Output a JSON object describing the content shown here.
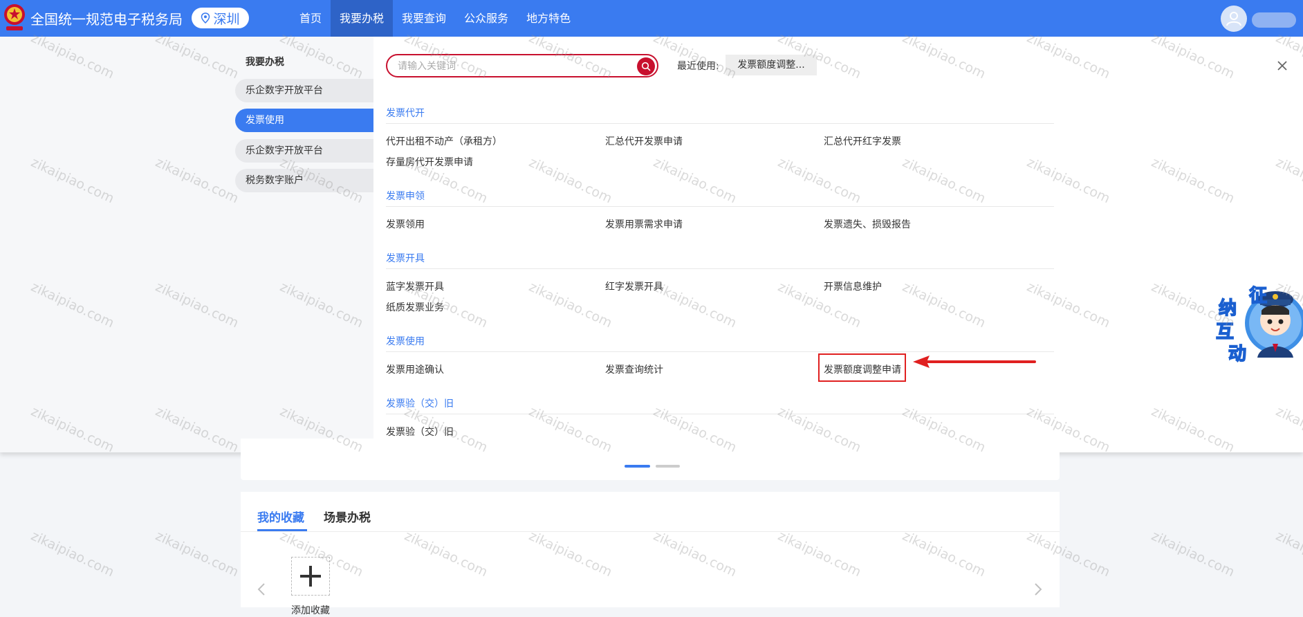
{
  "header": {
    "site_title": "全国统一规范电子税务局",
    "city": "深圳",
    "nav": [
      {
        "label": "首页",
        "active": false
      },
      {
        "label": "我要办税",
        "active": true
      },
      {
        "label": "我要查询",
        "active": false
      },
      {
        "label": "公众服务",
        "active": false
      },
      {
        "label": "地方特色",
        "active": false
      }
    ]
  },
  "menu": {
    "side_title": "我要办税",
    "side_items": [
      {
        "label": "乐企数字开放平台",
        "active": false
      },
      {
        "label": "发票使用",
        "active": true
      },
      {
        "label": "乐企数字开放平台",
        "active": false
      },
      {
        "label": "税务数字账户",
        "active": false
      }
    ],
    "search": {
      "placeholder": "请输入关键词"
    },
    "recent": {
      "label": "最近使用:",
      "item": "发票额度调整..."
    },
    "categories": [
      {
        "title": "发票代开",
        "rows": [
          [
            "代开出租不动产（承租方）",
            "汇总代开发票申请",
            "汇总代开红字发票"
          ],
          [
            "存量房代开发票申请"
          ]
        ]
      },
      {
        "title": "发票申领",
        "rows": [
          [
            "发票领用",
            "发票用票需求申请",
            "发票遗失、损毁报告"
          ]
        ]
      },
      {
        "title": "发票开具",
        "rows": [
          [
            "蓝字发票开具",
            "红字发票开具",
            "开票信息维护"
          ],
          [
            "纸质发票业务"
          ]
        ]
      },
      {
        "title": "发票使用",
        "rows": [
          [
            "发票用途确认",
            "发票查询统计",
            "发票额度调整申请"
          ]
        ]
      },
      {
        "title": "发票验（交）旧",
        "rows": [
          [
            "发票验（交）旧"
          ]
        ]
      }
    ]
  },
  "mascot": {
    "chars": [
      "征",
      "纳",
      "互",
      "动"
    ]
  },
  "favorites": {
    "tabs": [
      {
        "label": "我的收藏",
        "active": true
      },
      {
        "label": "场景办税",
        "active": false
      }
    ],
    "add_label": "添加收藏"
  },
  "watermark": {
    "text": "zikaipiao.com"
  },
  "colors": {
    "primary": "#3a7bf0",
    "nav_active": "#2e63c7",
    "search_border": "#c8102e",
    "annotation": "#e02020"
  }
}
